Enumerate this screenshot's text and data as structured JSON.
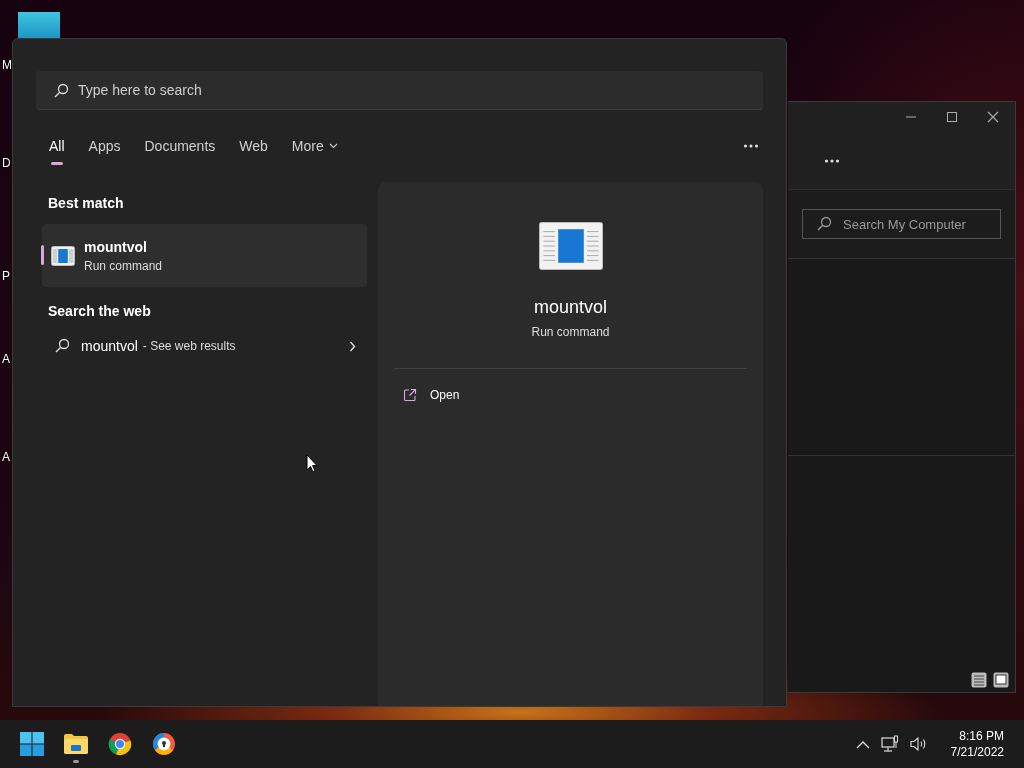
{
  "desktop_icons": [
    {
      "label": "M"
    },
    {
      "label": "D"
    },
    {
      "label": "P"
    },
    {
      "label": "A"
    },
    {
      "label": "A"
    }
  ],
  "explorer_window": {
    "search": {
      "placeholder": "Search My Computer"
    }
  },
  "search_panel": {
    "search": {
      "placeholder": "Type here to search"
    },
    "tabs": [
      {
        "label": "All",
        "selected": true,
        "kind": "plain"
      },
      {
        "label": "Apps",
        "selected": false,
        "kind": "plain"
      },
      {
        "label": "Documents",
        "selected": false,
        "kind": "plain"
      },
      {
        "label": "Web",
        "selected": false,
        "kind": "plain"
      },
      {
        "label": "More",
        "selected": false,
        "kind": "dropdown"
      }
    ],
    "best_match": {
      "heading": "Best match",
      "name": "mountvol",
      "type": "Run command",
      "selected": true
    },
    "web": {
      "heading": "Search the web",
      "query": "mountvol",
      "suffix": "- See web results"
    },
    "preview": {
      "name": "mountvol",
      "type": "Run command",
      "actions": [
        {
          "label": "Open"
        }
      ]
    }
  },
  "taskbar": {
    "apps": [
      {
        "kind": "start",
        "running": false
      },
      {
        "kind": "folder",
        "running": true
      },
      {
        "kind": "chrome",
        "running": false
      },
      {
        "kind": "browser",
        "running": false
      }
    ],
    "time": "8:16 PM",
    "date": "7/21/2022"
  }
}
